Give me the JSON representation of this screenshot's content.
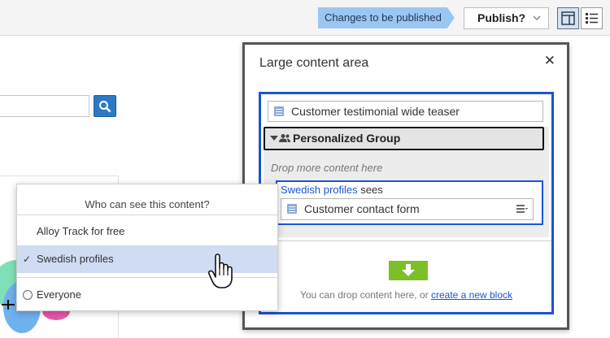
{
  "toolbar": {
    "status_badge": "Changes to be published",
    "publish_label": "Publish?",
    "publish_chevron": "chevron-down-icon",
    "view_buttons": [
      "layout-panels-icon",
      "list-view-icon"
    ]
  },
  "dialog": {
    "title": "Large content area",
    "close_icon": "close-icon",
    "items": [
      {
        "label": "Customer testimonial wide teaser",
        "icon": "document-icon"
      }
    ],
    "group": {
      "label": "Personalized Group",
      "icon": "users-icon",
      "drop_hint": "Drop more content here",
      "variant": {
        "audience": "Swedish profiles",
        "sees_suffix": "sees",
        "block_label": "Customer contact form",
        "block_icon": "document-icon",
        "menu_icon": "context-menu-icon"
      }
    },
    "drop_zone": {
      "text": "You can drop content here, or",
      "link": "create a new block",
      "icon": "down-arrow-icon"
    }
  },
  "popup": {
    "title": "Who can see this content?",
    "options": [
      {
        "label": "Alloy Track for free",
        "selected": false
      },
      {
        "label": "Swedish profiles",
        "selected": true
      },
      {
        "label": "Everyone",
        "selected": false
      }
    ]
  },
  "colors": {
    "accent": "#1a54d4",
    "badge": "#9cc6f2",
    "drop_arrow": "#7cbf27",
    "selected_row": "#cfdcf3"
  }
}
